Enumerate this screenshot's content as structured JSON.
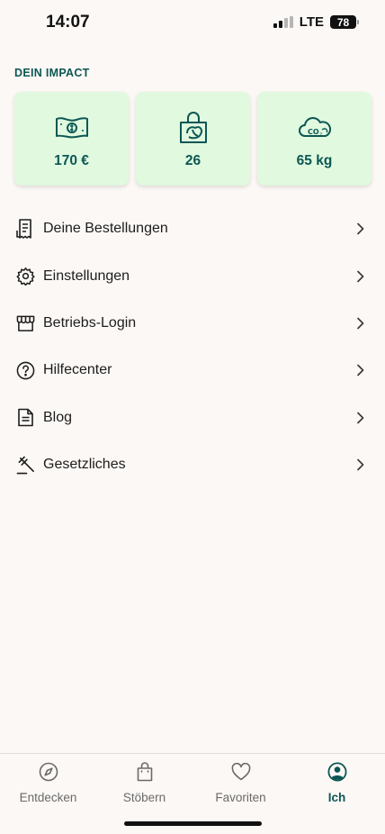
{
  "status_bar": {
    "time": "14:07",
    "network": "LTE",
    "battery": "78"
  },
  "impact": {
    "title": "DEIN IMPACT",
    "cards": [
      {
        "icon": "money-icon",
        "value": "170 €"
      },
      {
        "icon": "shopping-bag-food-icon",
        "value": "26"
      },
      {
        "icon": "co2-cloud-icon",
        "value": "65 kg"
      }
    ]
  },
  "menu": {
    "items": [
      {
        "icon": "receipt-icon",
        "label": "Deine Bestellungen"
      },
      {
        "icon": "gear-icon",
        "label": "Einstellungen"
      },
      {
        "icon": "store-icon",
        "label": "Betriebs-Login"
      },
      {
        "icon": "help-icon",
        "label": "Hilfecenter"
      },
      {
        "icon": "document-icon",
        "label": "Blog"
      },
      {
        "icon": "gavel-icon",
        "label": "Gesetzliches"
      }
    ]
  },
  "tab_bar": {
    "tabs": [
      {
        "icon": "compass-icon",
        "label": "Entdecken",
        "active": false
      },
      {
        "icon": "bag-icon",
        "label": "Stöbern",
        "active": false
      },
      {
        "icon": "heart-icon",
        "label": "Favoriten",
        "active": false
      },
      {
        "icon": "profile-icon",
        "label": "Ich",
        "active": true
      }
    ]
  },
  "colors": {
    "accent": "#0b5754",
    "card_background": "#e1f9df",
    "page_background": "#fcf8f5"
  }
}
